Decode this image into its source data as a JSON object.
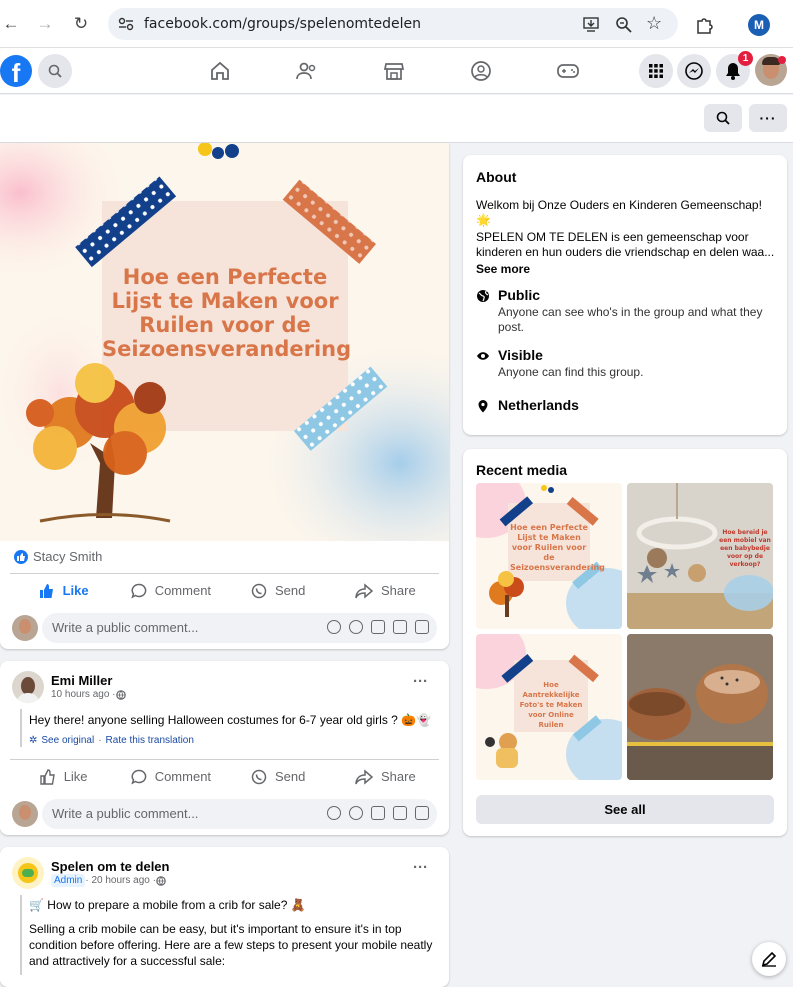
{
  "browser": {
    "url": "facebook.com/groups/spelenomtedelen",
    "profile_initial": "M"
  },
  "nav": {
    "notif_count": "1"
  },
  "post1": {
    "image_text": "Hoe een Perfecte Lijst te Maken voor Ruilen voor de Seizoensverandering",
    "reactor": "Stacy Smith",
    "actions": {
      "like": "Like",
      "comment": "Comment",
      "send": "Send",
      "share": "Share"
    },
    "comment_placeholder": "Write a public comment..."
  },
  "post2": {
    "author": "Emi Miller",
    "time": "10 hours ago · ",
    "text": "Hey there! anyone selling Halloween costumes for 6-7 year old girls ? 🎃👻",
    "see_original": "See original",
    "rate": "Rate this translation",
    "actions": {
      "like": "Like",
      "comment": "Comment",
      "send": "Send",
      "share": "Share"
    },
    "comment_placeholder": "Write a public comment..."
  },
  "post3": {
    "author": "Spelen om te delen",
    "badge": "Admin",
    "time": " · 20 hours ago · ",
    "line1": "🛒 How to prepare a mobile from a crib for sale? 🧸",
    "line2": "Selling a crib mobile can be easy, but it's important to ensure it's in top condition before offering. Here are a few steps to present your mobile neatly and attractively for a successful sale:"
  },
  "about": {
    "title": "About",
    "welcome": "Welkom bij Onze Ouders en Kinderen Gemeenschap! 🌟",
    "desc": "SPELEN OM TE DELEN is een gemeenschap voor kinderen en hun ouders die vriendschap en delen waa...",
    "see_more": "See more",
    "public_title": "Public",
    "public_sub": "Anyone can see who's in the group and what they post.",
    "visible_title": "Visible",
    "visible_sub": "Anyone can find this group.",
    "location": "Netherlands"
  },
  "recent_media": {
    "title": "Recent media",
    "tile1": "Hoe een Perfecte Lijst te Maken voor Ruilen voor de Seizoensverandering",
    "tile2": "Hoe bereid je een mobiel van een babybedje voor op de verkoop?",
    "tile3": "Hoe Aantrekkelijke Foto's te Maken voor Online Ruilen",
    "see_all": "See all"
  },
  "colors": {
    "fb_blue": "#1877f2",
    "title_orange": "#d8764a",
    "badge_bg": "#e7f3ff"
  }
}
